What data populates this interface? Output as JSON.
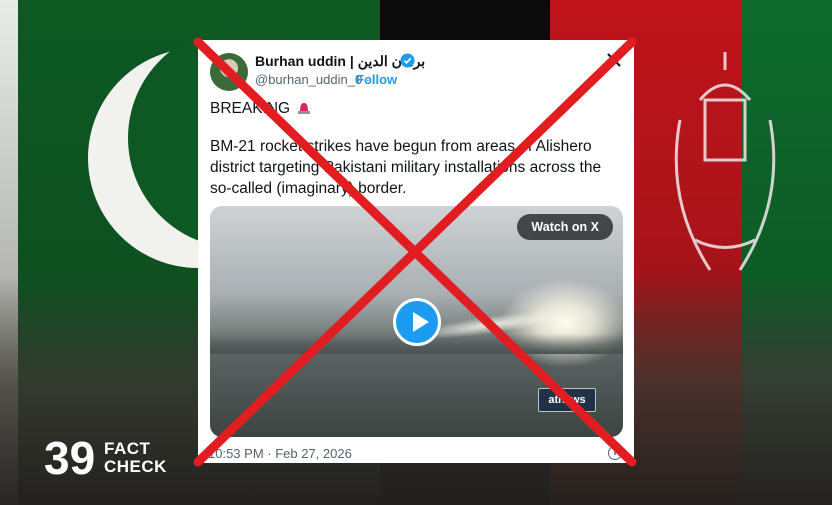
{
  "tweet": {
    "display_name": "Burhan uddin | برهان الدين",
    "handle": "@burhan_uddin_0 ·",
    "follow_label": "Follow",
    "breaking": "BREAKING",
    "body_lines": [
      "BM-21 rocket strikes have begun from areas of Alishero",
      "district targeting Pakistani military installations across the",
      "so-called (imaginary) border."
    ],
    "watch_label": "Watch on X",
    "news_logo_text": "atnews",
    "timestamp": "10:53 PM · Feb 27, 2026",
    "info_icon": "i"
  },
  "logo": {
    "number": "39",
    "line1": "FACT",
    "line2": "CHECK"
  },
  "colors": {
    "accent": "#1d9bf0",
    "cross": "#e11d22"
  }
}
